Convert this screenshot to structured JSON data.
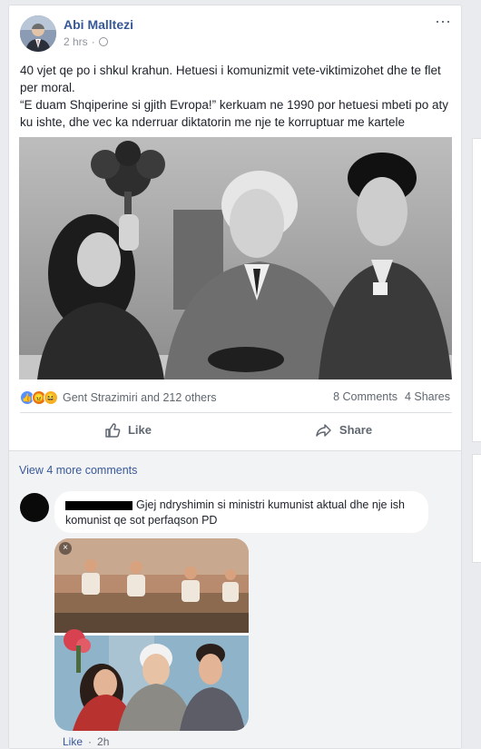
{
  "post": {
    "author": "Abi Malltezi",
    "time": "2 hrs",
    "time_separator": "·",
    "more_icon": "⋯",
    "text_lines": [
      "40 vjet qe po i shkul krahun. Hetuesi i komunizmit vete-viktimizohet dhe te flet per moral.",
      "“E duam Shqiperine si gjith Evropa!” kerkuam ne 1990 por hetuesi mbeti po aty ku ishte, dhe vec ka nderruar diktatorin me nje te korruptuar me kartele"
    ]
  },
  "reactions": {
    "icons": [
      "like-reaction",
      "angry-reaction",
      "haha-reaction"
    ],
    "names": "Gent Strazimiri and 212 others",
    "comments": "8 Comments",
    "shares": "4 Shares"
  },
  "actions": {
    "like": "Like",
    "share": "Share"
  },
  "comments": {
    "view_more": "View 4 more comments",
    "items": [
      {
        "text": "Gjej ndryshimin si ministri kumunist aktual dhe nje ish komunist qe sot perfaqson PD",
        "like": "Like",
        "separator": "·",
        "time": "2h",
        "close": "×"
      }
    ]
  },
  "colors": {
    "link": "#365899",
    "background": "#e9ebee",
    "comment_bg": "#f2f3f5"
  }
}
